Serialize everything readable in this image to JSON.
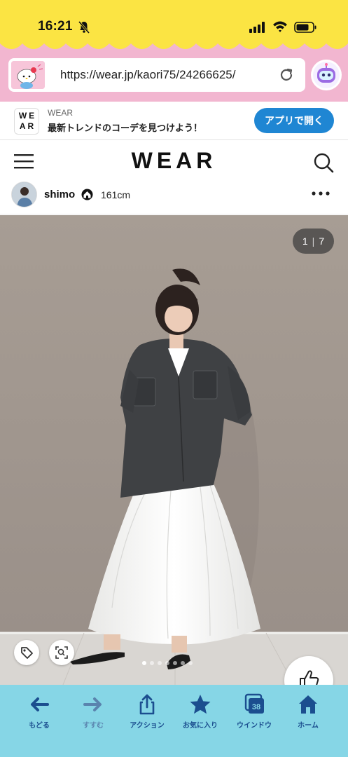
{
  "status_bar": {
    "time": "16:21"
  },
  "browser": {
    "url": "https://wear.jp/kaori75/24266625/"
  },
  "app_banner": {
    "logo_line1": "WE",
    "logo_line2": "AR",
    "app_name": "WEAR",
    "tagline": "最新トレンドのコーデを見つけよう！",
    "open_button": "アプリで開く"
  },
  "site_header": {
    "logo": "WEAR"
  },
  "user": {
    "name": "shimo",
    "height": "161cm"
  },
  "photo": {
    "counter_current": "1",
    "counter_total": "7",
    "current_page": 1,
    "total_pages": 7
  },
  "toolbar": {
    "items": [
      {
        "label": "もどる",
        "icon": "back-arrow-icon"
      },
      {
        "label": "すすむ",
        "icon": "forward-arrow-icon"
      },
      {
        "label": "アクション",
        "icon": "share-icon"
      },
      {
        "label": "お気に入り",
        "icon": "star-icon"
      },
      {
        "label": "ウインドウ",
        "icon": "windows-icon",
        "badge": "38"
      },
      {
        "label": "ホーム",
        "icon": "home-icon"
      }
    ]
  },
  "colors": {
    "status_band": "#fbe443",
    "chrome_pink": "#f2b6d0",
    "accent_blue": "#1f86d3",
    "toolbar_bg": "#86d6e6",
    "toolbar_text": "#1b4e8f"
  }
}
